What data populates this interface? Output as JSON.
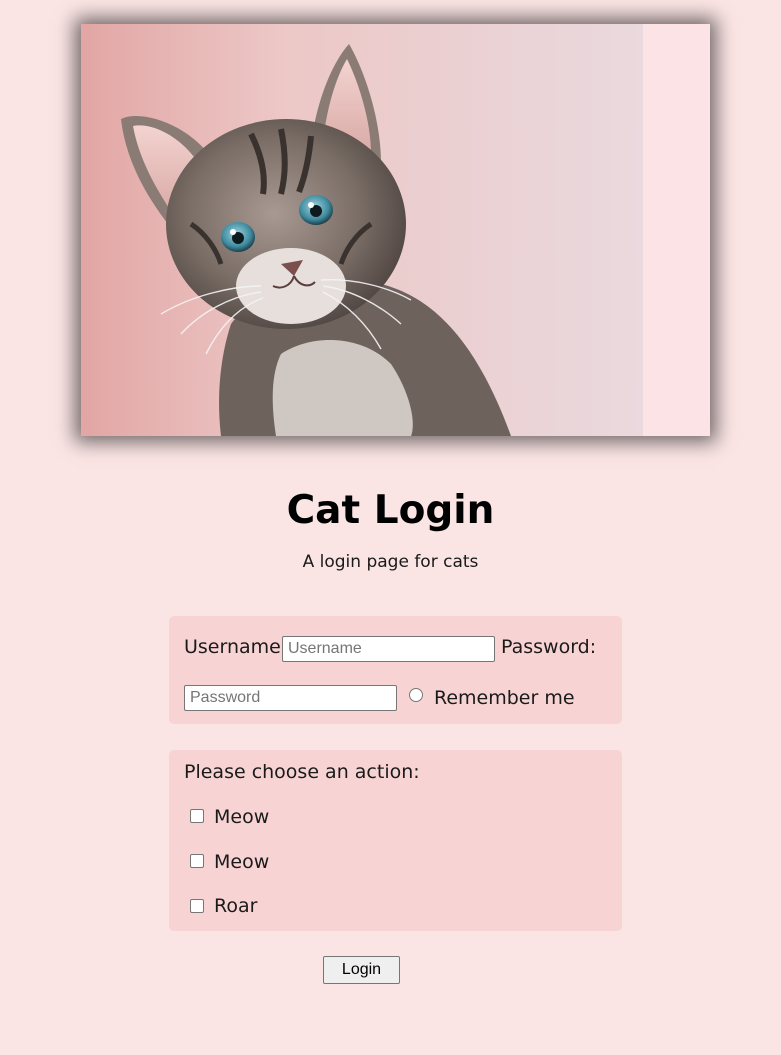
{
  "header": {
    "image_alt": "kitten photo",
    "title": "Cat Login",
    "subtitle": "A login page for cats"
  },
  "login_form": {
    "username_label": "Username:",
    "username_placeholder": "Username",
    "username_value": "",
    "password_label": "Password:",
    "password_placeholder": "Password",
    "password_value": "",
    "remember_label": "Remember me",
    "remember_checked": false
  },
  "action_form": {
    "prompt": "Please choose an action:",
    "options": [
      {
        "label": "Meow",
        "checked": false
      },
      {
        "label": "Meow",
        "checked": false
      },
      {
        "label": "Roar",
        "checked": false
      }
    ]
  },
  "submit": {
    "label": "Login"
  },
  "colors": {
    "page_background": "#fae4e4",
    "fieldset_background": "#f7d4d3"
  }
}
